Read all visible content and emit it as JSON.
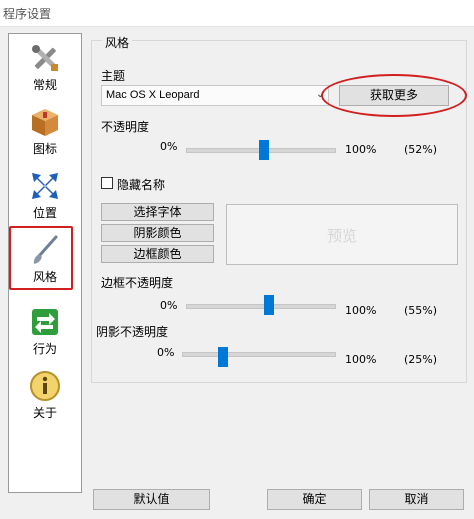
{
  "window": {
    "title": "程序设置"
  },
  "sidebar": {
    "items": [
      {
        "label": "常规",
        "icon": "tools-icon"
      },
      {
        "label": "图标",
        "icon": "box-icon"
      },
      {
        "label": "位置",
        "icon": "position-arrows-icon"
      },
      {
        "label": "风格",
        "icon": "brush-icon",
        "active": true
      },
      {
        "label": "行为",
        "icon": "behavior-arrows-icon"
      },
      {
        "label": "关于",
        "icon": "info-icon"
      }
    ],
    "highlight_color": "#d21f1f"
  },
  "style_panel": {
    "group_title": "风格",
    "theme": {
      "label": "主题",
      "value": "Mac OS X Leopard",
      "get_more": "获取更多"
    },
    "opacity": {
      "label": "不透明度",
      "min": "0%",
      "max": "100%",
      "value_text": "(52%)",
      "value": 52
    },
    "hide_names": {
      "label": "隐藏名称",
      "checked": false
    },
    "buttons": {
      "font": "选择字体",
      "shadow_color": "阴影颜色",
      "border_color": "边框颜色"
    },
    "preview": {
      "text": "预览"
    },
    "border_opacity": {
      "label": "边框不透明度",
      "min": "0%",
      "max": "100%",
      "value_text": "(55%)",
      "value": 55
    },
    "shadow_opacity": {
      "label": "阴影不透明度",
      "min": "0%",
      "max": "100%",
      "value_text": "(25%)",
      "value": 25
    }
  },
  "footer": {
    "default": "默认值",
    "ok": "确定",
    "cancel": "取消"
  },
  "colors": {
    "accent": "#0078d7",
    "annotation": "#d21f1f"
  }
}
